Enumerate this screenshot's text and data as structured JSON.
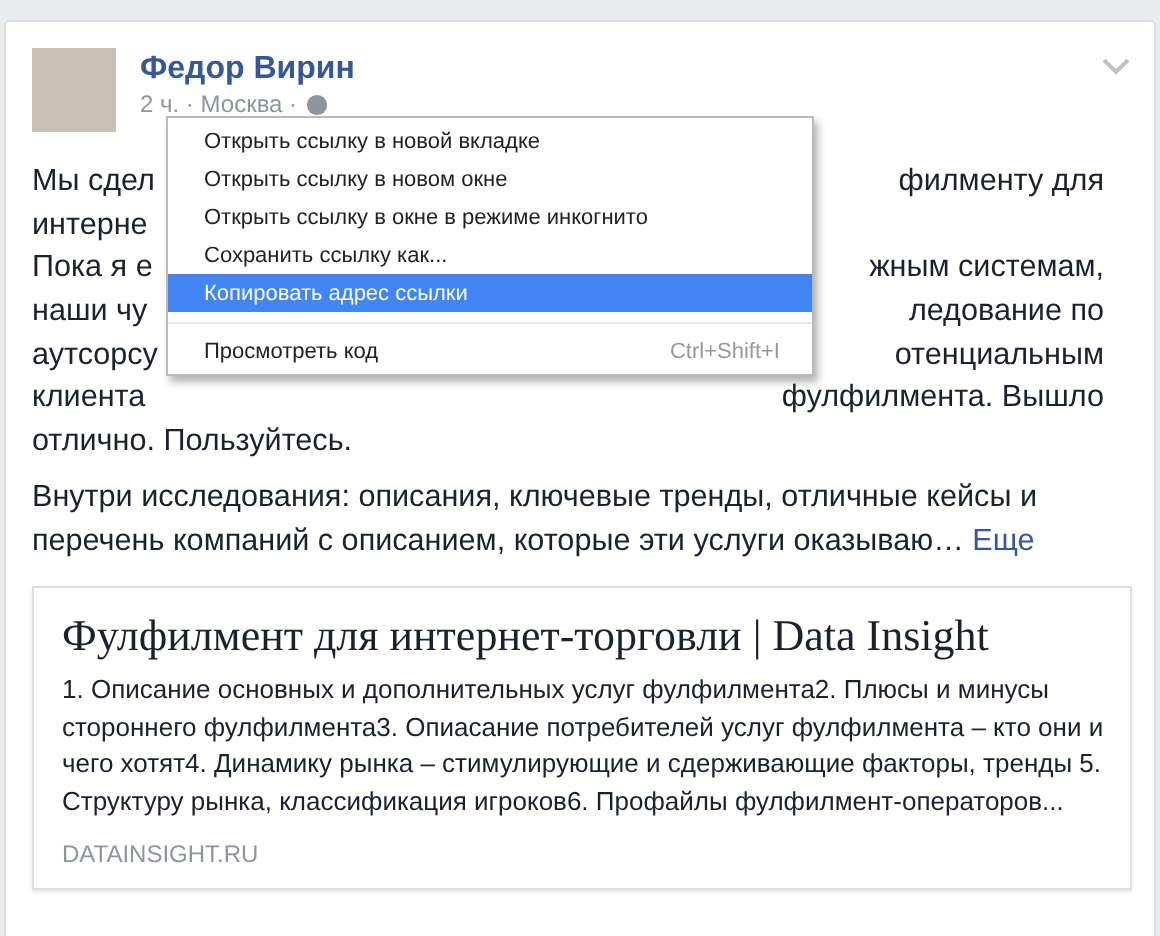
{
  "post": {
    "author": "Федор Вирин",
    "meta": "2 ч. · Москва ·",
    "visible_lines": [
      {
        "left": "Мы сдел",
        "right": "филменту для"
      },
      {
        "left": "интерне"
      },
      {
        "left": "Пока я е",
        "right": "жным системам,"
      },
      {
        "left": "наши чу",
        "right": "ледование по"
      },
      {
        "left": "аутсорсу",
        "right": "отенциальным"
      },
      {
        "left": "клиента",
        "right": "фулфилмента. Вышло"
      },
      {
        "left": "отлично. Пользуйтесь."
      }
    ],
    "paragraph_2": "Внутри исследования: описания, ключевые тренды, отличные кейсы и перечень компаний с описанием, которые эти услуги оказываю…",
    "more_link": "Еще"
  },
  "link_preview": {
    "title": "Фулфилмент для интернет-торговли | Data Insight",
    "description": "1. Описание основных и дополнительных услуг фулфилмента2. Плюсы и минусы стороннего фулфилмента3. Опиасание потребителей услуг фулфилмента – кто они и чего хотят4. Динамику рынка – стимулирующие и сдерживающие факторы, тренды 5. Структуру рынка, классификация игроков6. Профайлы фулфилмент-операторов...",
    "domain": "DATAINSIGHT.RU"
  },
  "context_menu": {
    "items": [
      {
        "label": "Открыть ссылку в новой вкладке",
        "selected": false,
        "separator_before": false
      },
      {
        "label": "Открыть ссылку в новом окне",
        "selected": false,
        "separator_before": false
      },
      {
        "label": "Открыть ссылку в окне в режиме инкогнито",
        "selected": false,
        "separator_before": false
      },
      {
        "label": "Сохранить ссылку как...",
        "selected": false,
        "separator_before": false
      },
      {
        "label": "Копировать адрес ссылки",
        "selected": true,
        "separator_before": false
      },
      {
        "label": "Просмотреть код",
        "shortcut": "Ctrl+Shift+I",
        "selected": false,
        "separator_before": true
      }
    ]
  }
}
